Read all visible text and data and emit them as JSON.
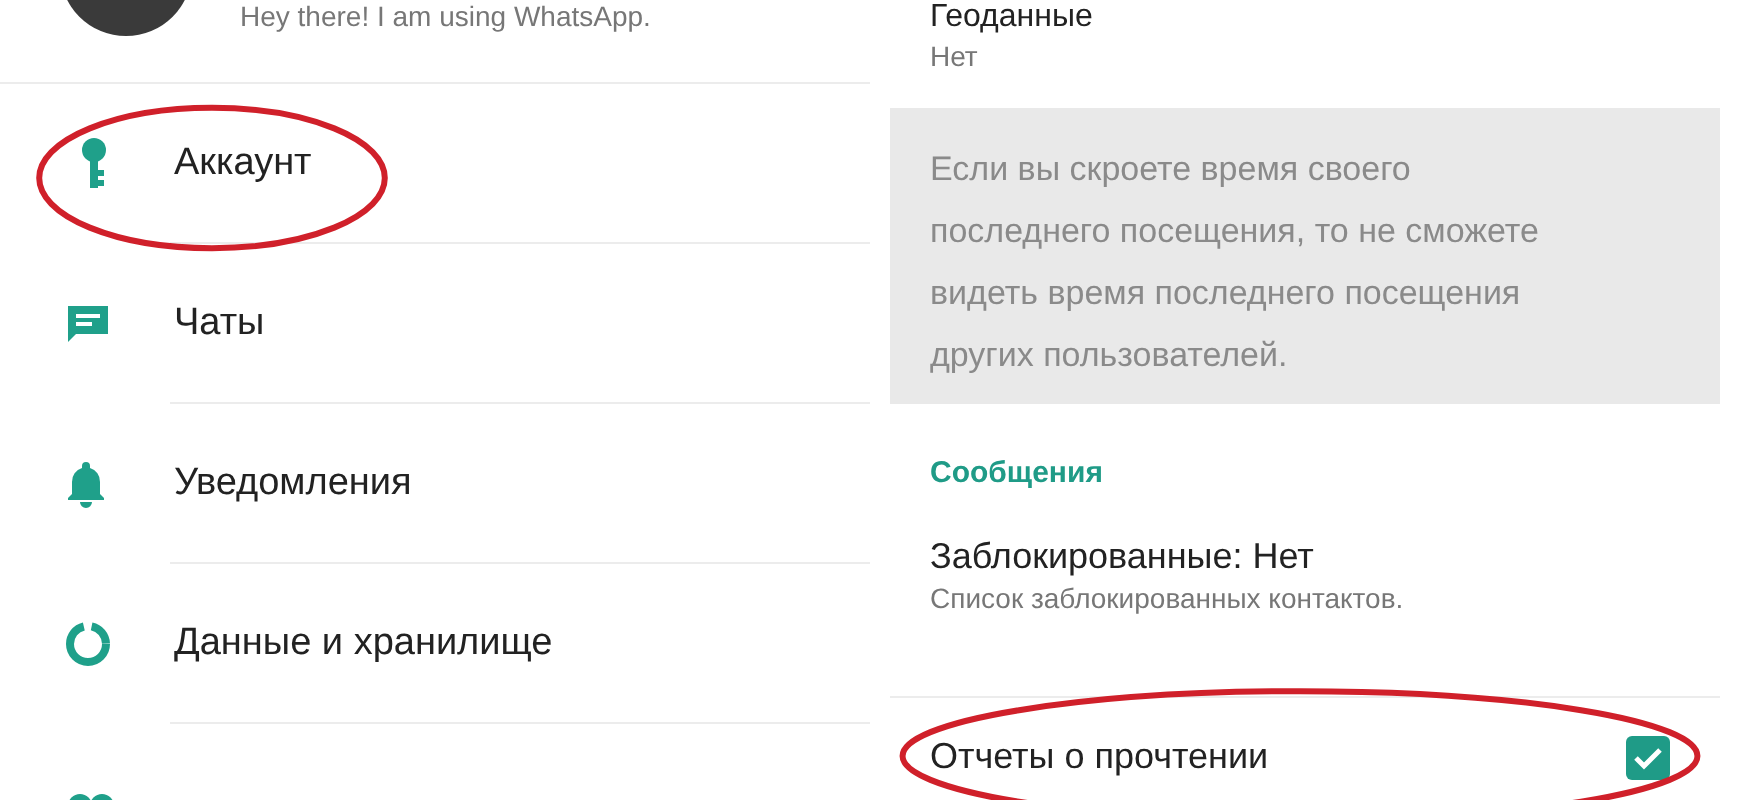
{
  "profile": {
    "status": "Hey there! I am using WhatsApp."
  },
  "settings_menu": [
    {
      "kind": "key",
      "label": "Аккаунт",
      "circled": true
    },
    {
      "kind": "chat",
      "label": "Чаты",
      "circled": false
    },
    {
      "kind": "bell",
      "label": "Уведомления",
      "circled": false
    },
    {
      "kind": "data",
      "label": "Данные и хранилище",
      "circled": false
    },
    {
      "kind": "contacts",
      "circled": false
    }
  ],
  "privacy": {
    "live_location": {
      "title": "Геоданные",
      "value": "Нет"
    },
    "note": "Если вы скроете время своего последнего посещения, то не сможете видеть время последнего посещения других пользователей.",
    "section": "Сообщения",
    "blocked": {
      "title": "Заблокированные: Нет",
      "subtitle": "Список заблокированных контактов."
    },
    "read_receipts": {
      "label": "Отчеты о прочтении",
      "checked": true,
      "circled": true
    }
  }
}
